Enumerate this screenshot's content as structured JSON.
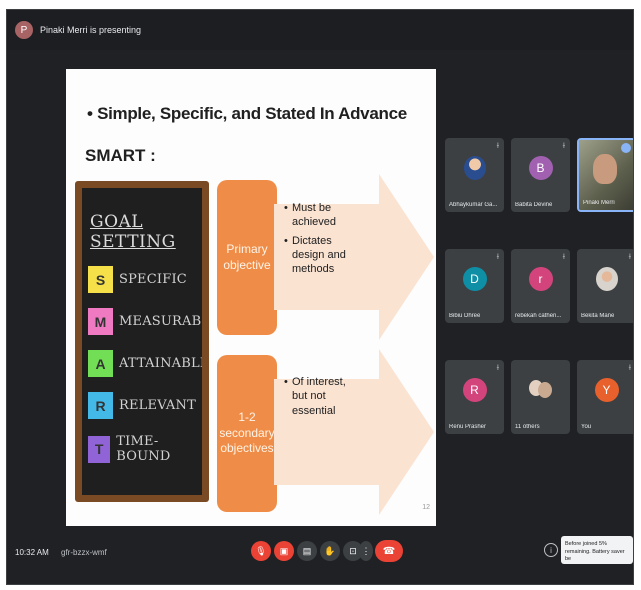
{
  "topbar": {
    "presenter_label": "Pinaki Merri is presenting",
    "presenter_initial": "P"
  },
  "slide": {
    "bullet": "• Simple, Specific, and Stated In Advance",
    "subtitle": "SMART :",
    "board_title": "GOAL SETTING",
    "goals": [
      {
        "letter": "S",
        "word": "SPECIFIC",
        "color": "#f6e04a"
      },
      {
        "letter": "M",
        "word": "MEASURABLE",
        "color": "#f07ac2"
      },
      {
        "letter": "A",
        "word": "ATTAINABLE",
        "color": "#72de56"
      },
      {
        "letter": "R",
        "word": "RELEVANT",
        "color": "#43b9e8"
      },
      {
        "letter": "T",
        "word": "TIME-BOUND",
        "color": "#9063d6"
      }
    ],
    "primary_label": "Primary objective",
    "primary_points": [
      "Must be achieved",
      "Dictates design and methods"
    ],
    "secondary_label": "1-2 secondary objectives",
    "secondary_points": [
      "Of interest, but not essential"
    ],
    "slide_number": "12"
  },
  "participants": [
    {
      "name": "Abhaykumar Ga...",
      "initial": "",
      "color": "#5f6368",
      "kind": "photo"
    },
    {
      "name": "Babita Devine",
      "initial": "B",
      "color": "#a161b0",
      "kind": "avatar"
    },
    {
      "name": "Pinaki Merri",
      "initial": "",
      "color": "#5f6368",
      "kind": "video"
    },
    {
      "name": "Bibiu Dhree",
      "initial": "D",
      "color": "#0e8fa6",
      "kind": "avatar"
    },
    {
      "name": "rebekah catheri...",
      "initial": "r",
      "color": "#d4447c",
      "kind": "avatar"
    },
    {
      "name": "Bekita Mane",
      "initial": "",
      "color": "#5f6368",
      "kind": "photo"
    },
    {
      "name": "Renu Prasher",
      "initial": "R",
      "color": "#d4447c",
      "kind": "avatar"
    },
    {
      "name": "11 others",
      "initial": "",
      "color": "#5f6368",
      "kind": "group"
    },
    {
      "name": "You",
      "initial": "Y",
      "color": "#e8602c",
      "kind": "avatar"
    }
  ],
  "bottombar": {
    "time": "10:32 AM",
    "meeting_code": "gfr-bzzx-wmf",
    "tooltip": "Before joined 5% remaining. Battery saver be"
  },
  "colors": {
    "accent_orange": "#ef8d48",
    "danger_red": "#ea4335"
  }
}
